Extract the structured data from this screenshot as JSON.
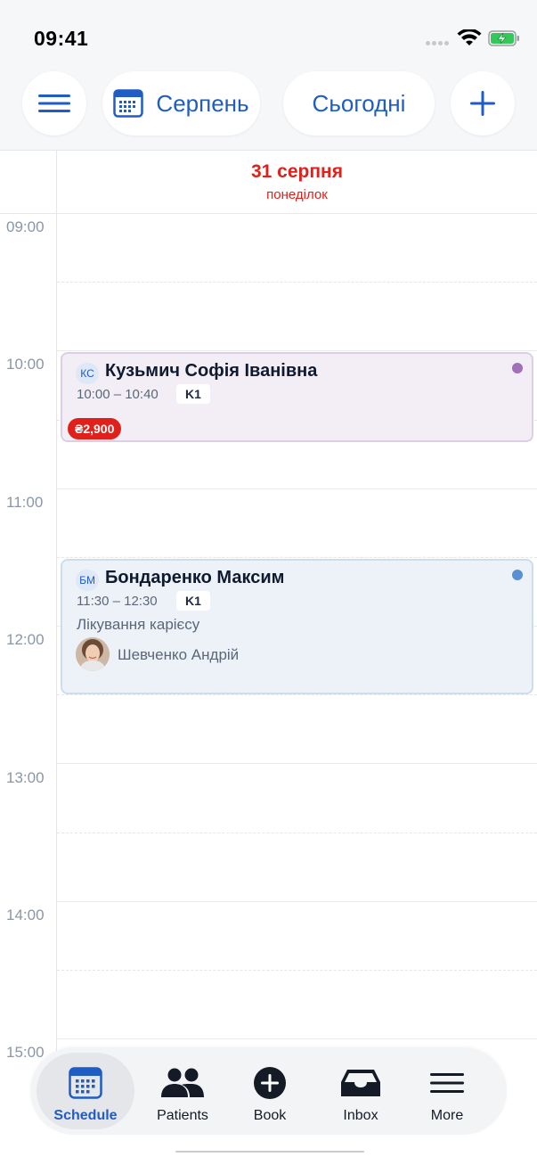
{
  "status_bar": {
    "time": "09:41"
  },
  "toolbar": {
    "menu_icon": "hamburger-menu-icon",
    "month_label": "Серпень",
    "today_label": "Сьогодні",
    "add_icon": "plus-icon"
  },
  "date_header": {
    "date": "31 серпня",
    "weekday": "понеділок"
  },
  "timeline": {
    "hours": [
      "09:00",
      "10:00",
      "11:00",
      "12:00",
      "13:00",
      "14:00",
      "15:00"
    ]
  },
  "appointments": [
    {
      "initials": "КС",
      "patient": "Кузьмич Софія Іванівна",
      "time": "10:00 – 10:40",
      "room": "K1",
      "price": "₴2,900",
      "status_color": "#a070b8"
    },
    {
      "initials": "БМ",
      "patient": "Бондаренко Максим",
      "time": "11:30 – 12:30",
      "room": "K1",
      "treatment": "Лікування карієсу",
      "doctor": "Шевченко Андрій",
      "status_color": "#5b8fd1"
    }
  ],
  "tab_bar": {
    "active": "Schedule",
    "tabs": [
      {
        "label": "Schedule",
        "icon": "calendar-icon"
      },
      {
        "label": "Patients",
        "icon": "people-icon"
      },
      {
        "label": "Book",
        "icon": "plus-circle-icon"
      },
      {
        "label": "Inbox",
        "icon": "inbox-tray-icon"
      },
      {
        "label": "More",
        "icon": "menu-lines-icon"
      }
    ]
  },
  "colors": {
    "accent": "#1f5cc4",
    "date_red": "#e0201a",
    "price_red": "#e0201a"
  }
}
